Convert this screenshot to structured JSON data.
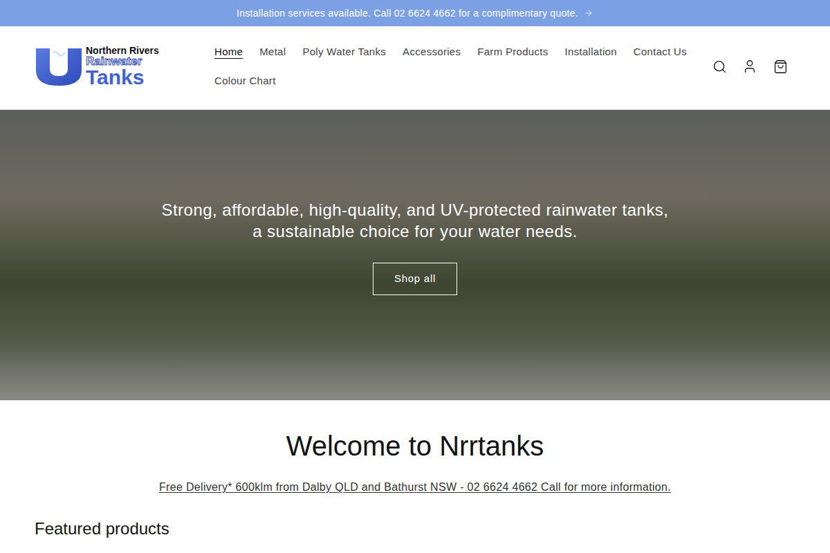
{
  "announcement": {
    "text": "Installation services available. Call 02 6624 4662 for a complimentary quote."
  },
  "logo": {
    "line1": "Northern Rivers",
    "line2": "Rainwater",
    "line3": "Tanks"
  },
  "nav": [
    {
      "label": "Home",
      "selected": true
    },
    {
      "label": "Metal",
      "selected": false
    },
    {
      "label": "Poly Water Tanks",
      "selected": false
    },
    {
      "label": "Accessories",
      "selected": false
    },
    {
      "label": "Farm Products",
      "selected": false
    },
    {
      "label": "Installation",
      "selected": false
    },
    {
      "label": "Contact Us",
      "selected": false
    },
    {
      "label": "Colour Chart",
      "selected": false
    }
  ],
  "hero": {
    "heading": "Strong, affordable, high-quality, and UV-protected rainwater tanks, a sustainable choice for your water needs.",
    "button": "Shop all"
  },
  "welcome": {
    "title": "Welcome to Nrrtanks",
    "link": "Free Delivery* 600klm from Dalby QLD and Bathurst NSW - 02 6624 4662 Call for more information."
  },
  "featured": {
    "title": "Featured products"
  }
}
